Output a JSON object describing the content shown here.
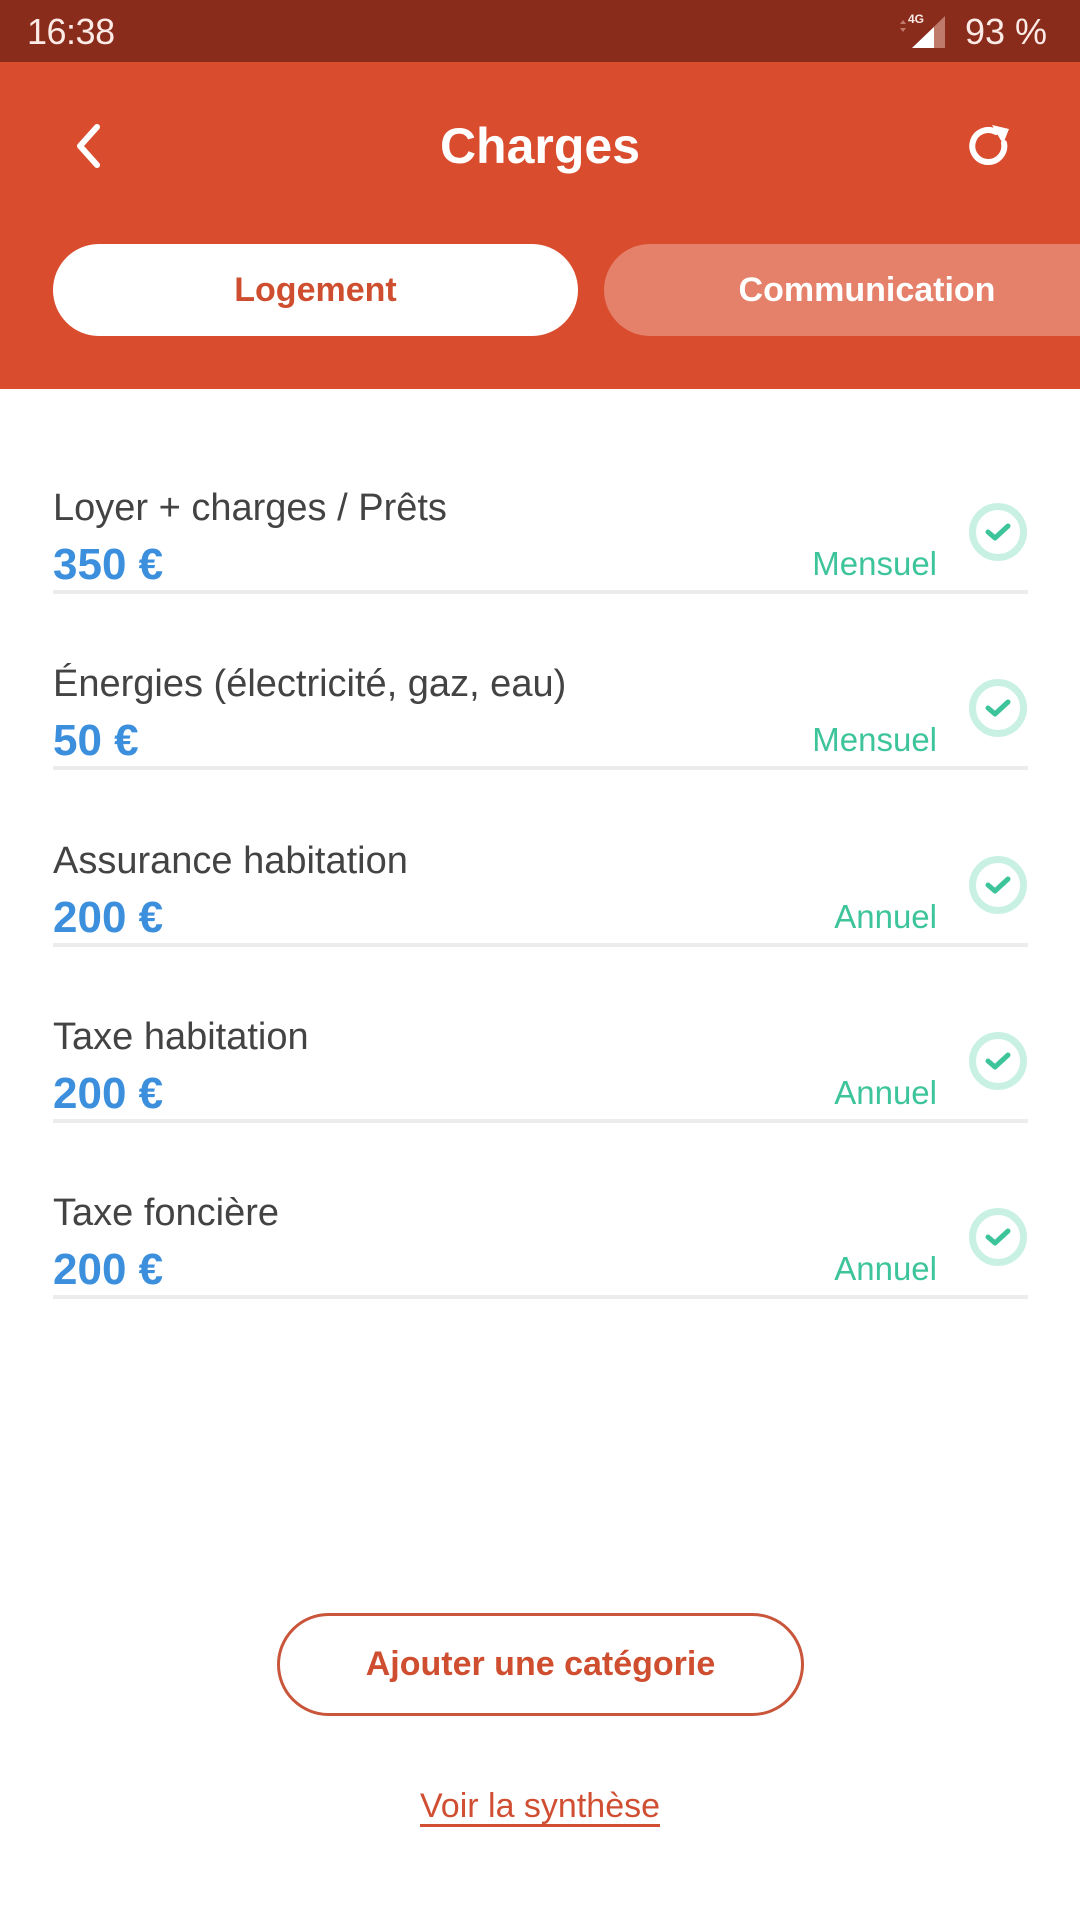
{
  "status_bar": {
    "time": "16:38",
    "network": "4G",
    "battery": "93 %"
  },
  "header": {
    "title": "Charges",
    "back_icon": "chevron-left-icon",
    "refresh_icon": "refresh-icon"
  },
  "tabs": [
    {
      "label": "Logement",
      "active": true
    },
    {
      "label": "Communication",
      "active": false
    }
  ],
  "charges": [
    {
      "title": "Loyer + charges / Prêts",
      "amount": "350 €",
      "period": "Mensuel",
      "checked": true
    },
    {
      "title": "Énergies (électricité, gaz, eau)",
      "amount": "50 €",
      "period": "Mensuel",
      "checked": true
    },
    {
      "title": "Assurance habitation",
      "amount": "200 €",
      "period": "Annuel",
      "checked": true
    },
    {
      "title": "Taxe habitation",
      "amount": "200 €",
      "period": "Annuel",
      "checked": true
    },
    {
      "title": "Taxe foncière",
      "amount": "200 €",
      "period": "Annuel",
      "checked": true
    }
  ],
  "actions": {
    "add_category": "Ajouter une catégorie",
    "view_summary": "Voir la synthèse"
  },
  "colors": {
    "status_bar": "#8a2c1c",
    "header": "#d94c2e",
    "accent": "#cf4e30",
    "amount": "#3b8fdc",
    "period": "#3dc49a",
    "check_ring": "#c9f1e3"
  }
}
